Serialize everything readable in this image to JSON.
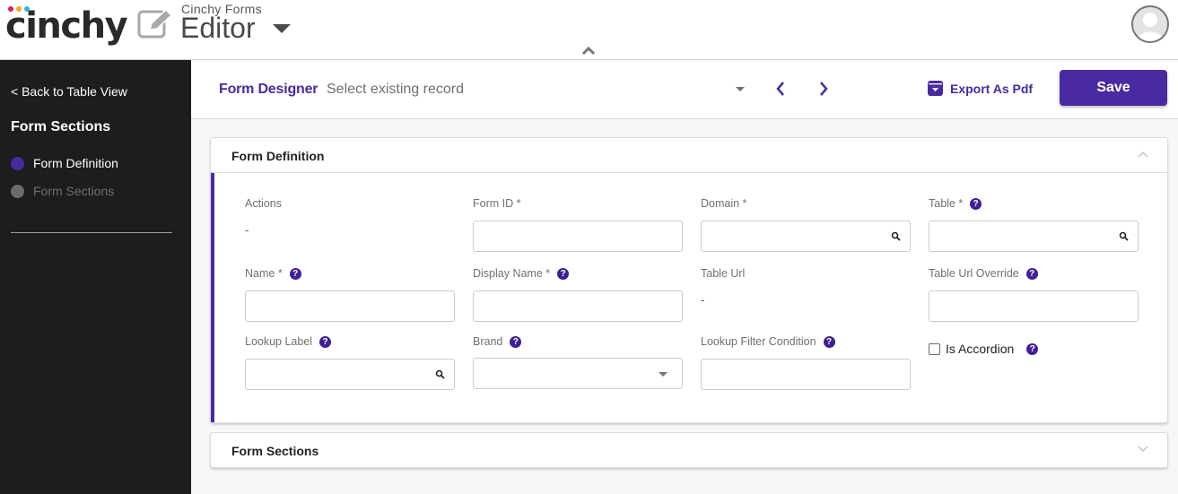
{
  "header": {
    "logo_text": "cinchy",
    "logo_dot_colors": [
      "#e8175d",
      "#f5a623",
      "#2bb3e8"
    ],
    "app_subtitle": "Cinchy Forms",
    "app_title": "Editor",
    "icons": {
      "edit": "pencil-square-icon",
      "menu": "caret-down-icon",
      "collapse": "chevron-up-icon",
      "user": "user-avatar-icon"
    }
  },
  "sidebar": {
    "back_link": "< Back to Table View",
    "title": "Form Sections",
    "items": [
      {
        "label": "Form Definition",
        "active": true,
        "dot_color": "#4a2aa0"
      },
      {
        "label": "Form Sections",
        "active": false,
        "dot_color": "#6b6b6b"
      }
    ]
  },
  "toolbar": {
    "form_designer_label": "Form Designer",
    "record_select_placeholder": "Select existing record",
    "prev_icon": "chevron-left-icon",
    "next_icon": "chevron-right-icon",
    "export_label": "Export As Pdf",
    "save_label": "Save",
    "accent_color": "#4a2aa0"
  },
  "form_definition": {
    "title": "Form Definition",
    "fields": {
      "actions": {
        "label": "Actions",
        "value": "-"
      },
      "form_id": {
        "label": "Form ID *",
        "value": ""
      },
      "domain": {
        "label": "Domain *",
        "value": ""
      },
      "table": {
        "label": "Table *",
        "value": ""
      },
      "name": {
        "label": "Name *",
        "value": ""
      },
      "display_name": {
        "label": "Display Name *",
        "value": ""
      },
      "table_url": {
        "label": "Table Url",
        "value": "-"
      },
      "table_url_override": {
        "label": "Table Url Override",
        "value": ""
      },
      "lookup_label": {
        "label": "Lookup Label",
        "value": ""
      },
      "brand": {
        "label": "Brand",
        "value": ""
      },
      "lookup_filter_condition": {
        "label": "Lookup Filter Condition",
        "value": ""
      },
      "is_accordion": {
        "label": "Is Accordion",
        "checked": false
      }
    },
    "help_glyph": "?"
  },
  "form_sections": {
    "title": "Form Sections"
  }
}
